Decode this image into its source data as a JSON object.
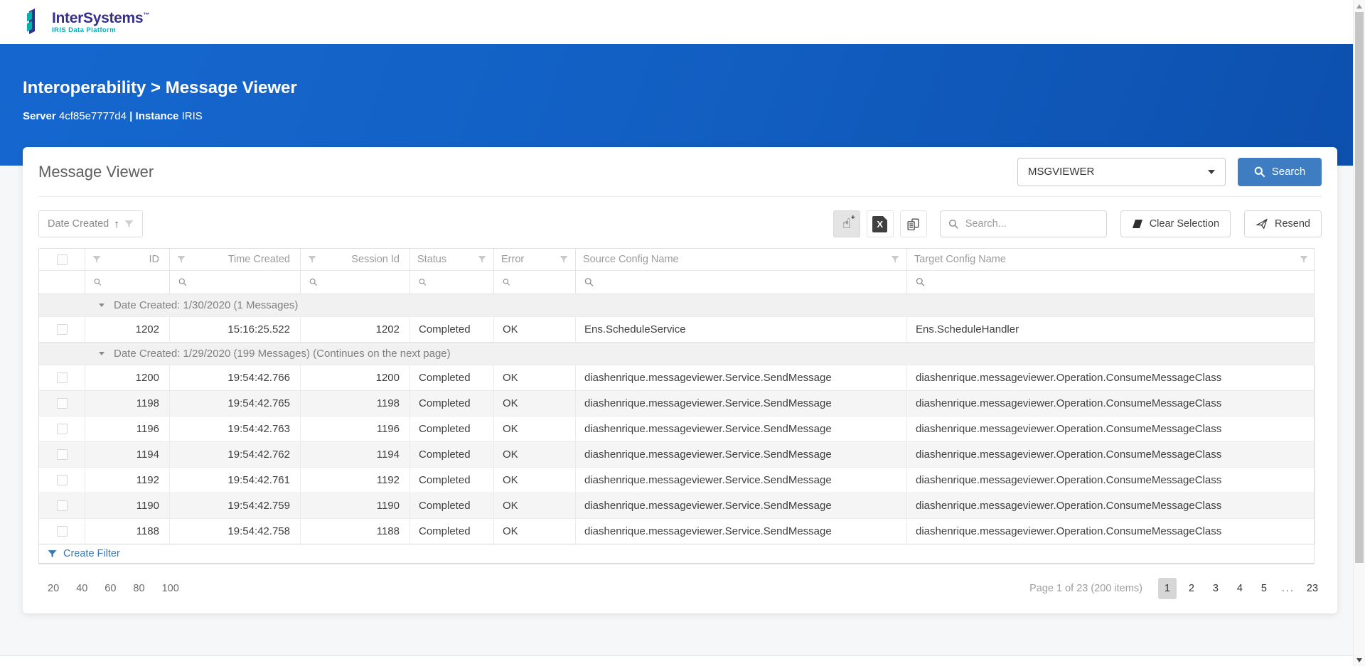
{
  "brand": {
    "name": "InterSystems",
    "trademark": "™",
    "tagline": "IRIS Data Platform"
  },
  "header": {
    "breadcrumb": "Interoperability > Message Viewer",
    "server_label": "Server",
    "server_value": "4cf85e7777d4",
    "divider": "|",
    "instance_label": "Instance",
    "instance_value": "IRIS"
  },
  "panel": {
    "title": "Message Viewer",
    "namespace_value": "MSGVIEWER",
    "search_button_label": "Search"
  },
  "toolbar": {
    "sort_label": "Date Created",
    "sort_direction": "↑",
    "icons": [
      "pointer-select-icon",
      "export-excel-icon",
      "column-chooser-icon"
    ],
    "search_placeholder": "Search...",
    "clear_selection_label": "Clear Selection",
    "resend_label": "Resend"
  },
  "table": {
    "columns": [
      "",
      "ID",
      "Time Created",
      "Session Id",
      "Status",
      "Error",
      "Source Config Name",
      "Target Config Name"
    ],
    "groups": [
      {
        "label": "Date Created: 1/30/2020 (1 Messages)",
        "rows": [
          [
            "1202",
            "15:16:25.522",
            "1202",
            "Completed",
            "OK",
            "Ens.ScheduleService",
            "Ens.ScheduleHandler"
          ]
        ]
      },
      {
        "label": "Date Created: 1/29/2020 (199 Messages) (Continues on the next page)",
        "rows": [
          [
            "1200",
            "19:54:42.766",
            "1200",
            "Completed",
            "OK",
            "diashenrique.messageviewer.Service.SendMessage",
            "diashenrique.messageviewer.Operation.ConsumeMessageClass"
          ],
          [
            "1198",
            "19:54:42.765",
            "1198",
            "Completed",
            "OK",
            "diashenrique.messageviewer.Service.SendMessage",
            "diashenrique.messageviewer.Operation.ConsumeMessageClass"
          ],
          [
            "1196",
            "19:54:42.763",
            "1196",
            "Completed",
            "OK",
            "diashenrique.messageviewer.Service.SendMessage",
            "diashenrique.messageviewer.Operation.ConsumeMessageClass"
          ],
          [
            "1194",
            "19:54:42.762",
            "1194",
            "Completed",
            "OK",
            "diashenrique.messageviewer.Service.SendMessage",
            "diashenrique.messageviewer.Operation.ConsumeMessageClass"
          ],
          [
            "1192",
            "19:54:42.761",
            "1192",
            "Completed",
            "OK",
            "diashenrique.messageviewer.Service.SendMessage",
            "diashenrique.messageviewer.Operation.ConsumeMessageClass"
          ],
          [
            "1190",
            "19:54:42.759",
            "1190",
            "Completed",
            "OK",
            "diashenrique.messageviewer.Service.SendMessage",
            "diashenrique.messageviewer.Operation.ConsumeMessageClass"
          ],
          [
            "1188",
            "19:54:42.758",
            "1188",
            "Completed",
            "OK",
            "diashenrique.messageviewer.Service.SendMessage",
            "diashenrique.messageviewer.Operation.ConsumeMessageClass"
          ]
        ]
      }
    ]
  },
  "footer": {
    "create_filter_label": "Create Filter",
    "page_sizes": [
      "20",
      "40",
      "60",
      "80",
      "100"
    ],
    "page_info": "Page 1 of 23 (200 items)",
    "pages": [
      "1",
      "2",
      "3",
      "4",
      "5",
      "...",
      "23"
    ],
    "current_page": "1"
  },
  "colors": {
    "header_blue_start": "#1567cf",
    "header_blue_end": "#0d50ae",
    "accent_blue": "#3e7dc1",
    "link_blue": "#3a77b8",
    "brand_navy": "#34308b",
    "brand_teal": "#00aebc",
    "group_row_bg": "#f1f1f1",
    "stripe_row_bg": "#f5f5f5",
    "current_page_bg": "#d6d6d6"
  }
}
